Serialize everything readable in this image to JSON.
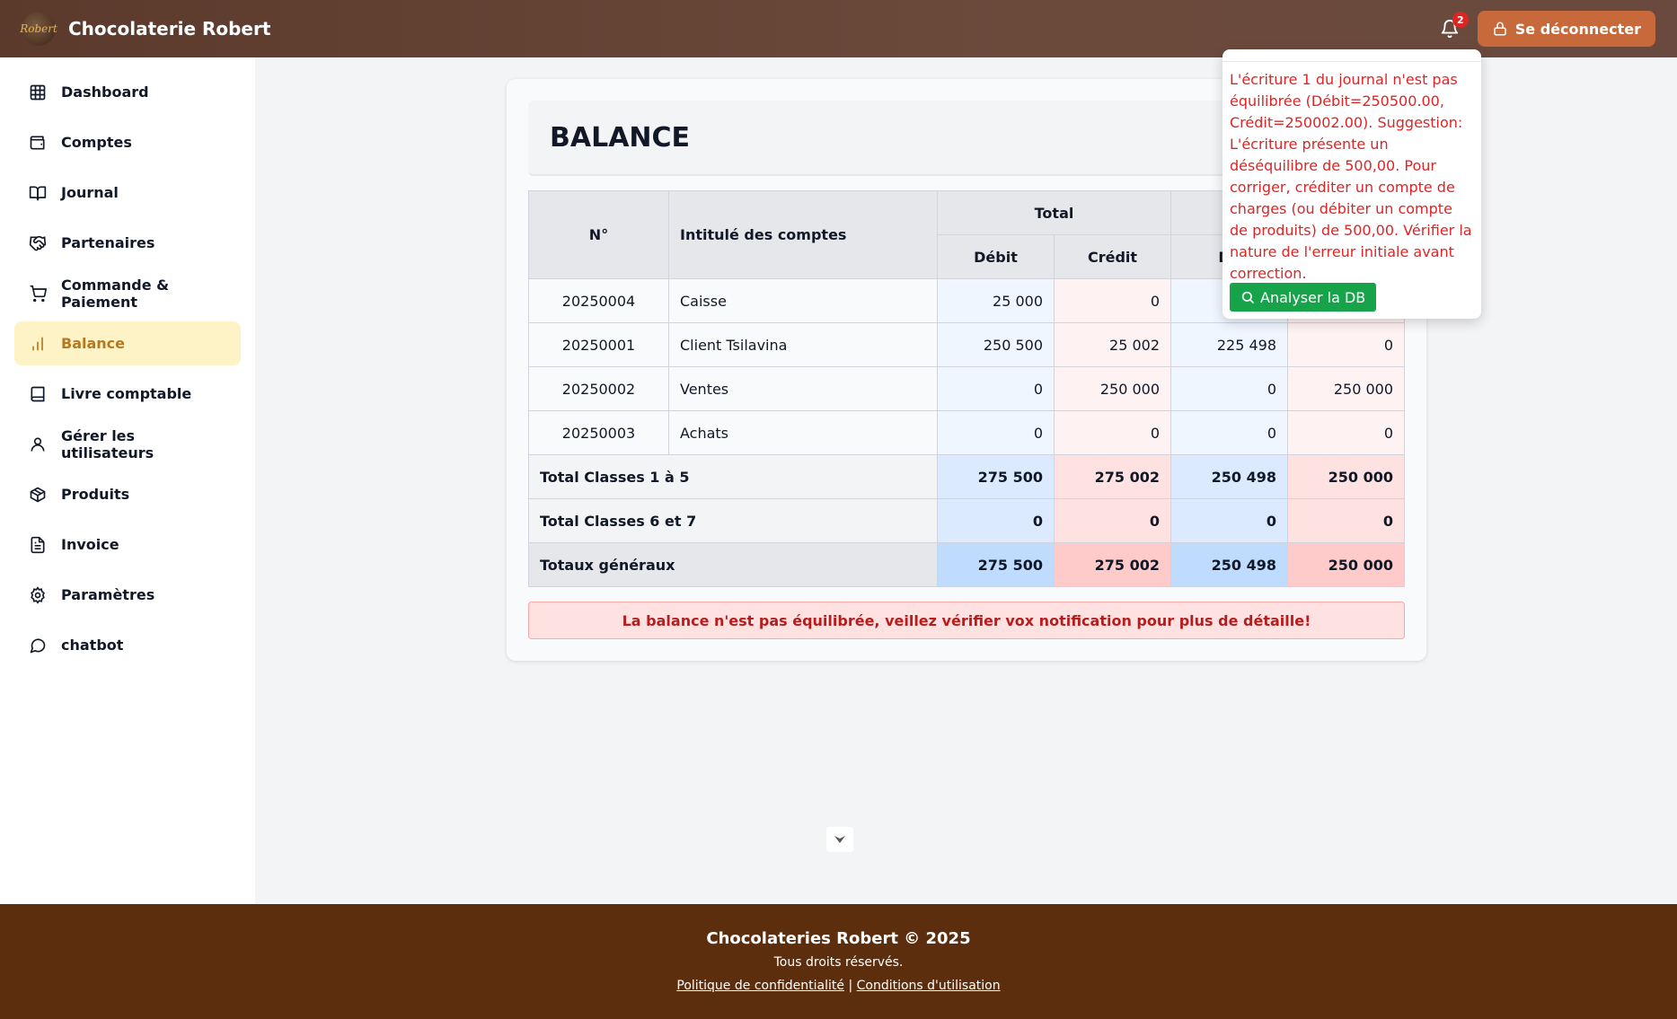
{
  "header": {
    "logo_text": "Robert",
    "brand": "Chocolaterie Robert",
    "notif_count": "2",
    "logout_label": "Se déconnecter"
  },
  "sidebar": {
    "items": [
      {
        "label": "Dashboard",
        "icon": "grid-icon"
      },
      {
        "label": "Comptes",
        "icon": "wallet-icon"
      },
      {
        "label": "Journal",
        "icon": "book-open-icon"
      },
      {
        "label": "Partenaires",
        "icon": "handshake-icon"
      },
      {
        "label": "Commande & Paiement",
        "icon": "cart-icon"
      },
      {
        "label": "Balance",
        "icon": "bar-chart-icon",
        "active": true
      },
      {
        "label": "Livre comptable",
        "icon": "book-icon"
      },
      {
        "label": "Gérer les utilisateurs",
        "icon": "user-icon"
      },
      {
        "label": "Produits",
        "icon": "package-icon"
      },
      {
        "label": "Invoice",
        "icon": "file-text-icon"
      },
      {
        "label": "Paramètres",
        "icon": "gear-icon"
      },
      {
        "label": "chatbot",
        "icon": "chat-icon"
      }
    ]
  },
  "main": {
    "title": "BALANCE",
    "table": {
      "headers": {
        "no": "N°",
        "label": "Intitulé des comptes",
        "total": "Total",
        "debit": "Débit",
        "credit": "Crédit",
        "partial": "De"
      },
      "rows": [
        {
          "no": "20250004",
          "label": "Caisse",
          "td": "25 000",
          "tc": "0",
          "sd": "",
          "sc": ""
        },
        {
          "no": "20250001",
          "label": "Client Tsilavina",
          "td": "250 500",
          "tc": "25 002",
          "sd": "225 498",
          "sc": "0"
        },
        {
          "no": "20250002",
          "label": "Ventes",
          "td": "0",
          "tc": "250 000",
          "sd": "0",
          "sc": "250 000"
        },
        {
          "no": "20250003",
          "label": "Achats",
          "td": "0",
          "tc": "0",
          "sd": "0",
          "sc": "0"
        }
      ],
      "subtotals": [
        {
          "label": "Total Classes 1 à 5",
          "td": "275 500",
          "tc": "275 002",
          "sd": "250 498",
          "sc": "250 000"
        },
        {
          "label": "Total Classes 6 et 7",
          "td": "0",
          "tc": "0",
          "sd": "0",
          "sc": "0"
        }
      ],
      "grand": {
        "label": "Totaux généraux",
        "td": "275 500",
        "tc": "275 002",
        "sd": "250 498",
        "sc": "250 000"
      }
    },
    "alert": "La balance n'est pas équilibrée, veillez vérifier vox notification pour plus de détaille!"
  },
  "notification_popup": {
    "message": "L'écriture 1 du journal n'est pas équilibrée (Débit=250500.00, Crédit=250002.00). Suggestion: L'écriture présente un déséquilibre de 500,00. Pour corriger, créditer un compte de charges (ou débiter un compte de produits) de 500,00. Vérifier la nature de l'erreur initiale avant correction.",
    "button_label": "Analyser la DB"
  },
  "footer": {
    "title": "Chocolateries Robert © 2025",
    "rights": "Tous droits réservés.",
    "privacy": "Politique de confidentialité",
    "separator": "|",
    "terms": "Conditions d'utilisation"
  },
  "colors": {
    "header_bg": "#5b3a2c",
    "logout_btn": "#c7693a",
    "active_nav_bg": "#fef3c7",
    "active_nav_text": "#b7791f",
    "footer_bg": "#5c2e0e",
    "alert_text": "#b91c1c",
    "analyze_btn": "#16a34a"
  }
}
